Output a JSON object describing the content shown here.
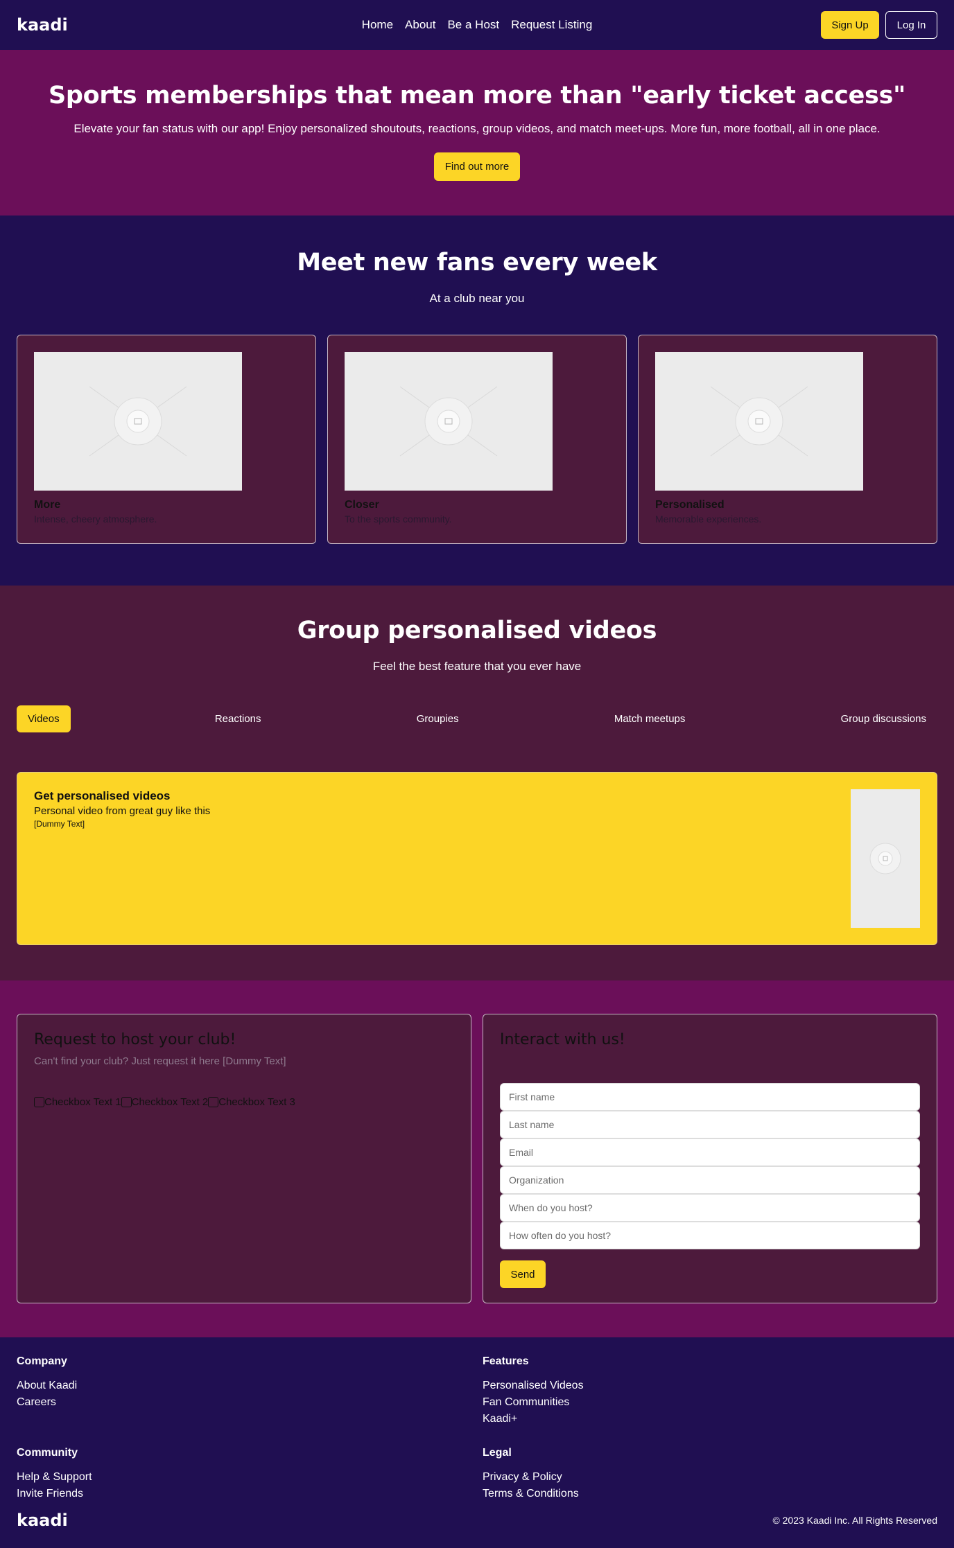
{
  "nav": {
    "logo": "kaadi",
    "links": [
      "Home",
      "About",
      "Be a Host",
      "Request Listing"
    ],
    "signup": "Sign Up",
    "login": "Log In"
  },
  "hero": {
    "title": "Sports memberships that mean more than \"early ticket access\"",
    "subtitle": "Elevate your fan status with our app! Enjoy personalized shoutouts, reactions, group videos, and match meet-ups. More fun, more football, all in one place.",
    "cta": "Find out more"
  },
  "meet": {
    "title": "Meet new fans every week",
    "subtitle": "At a club near you",
    "cards": [
      {
        "title": "More",
        "desc": "Intense, cheery atmosphere."
      },
      {
        "title": "Closer",
        "desc": "To the sports community."
      },
      {
        "title": "Personalised",
        "desc": "Memorable experiences."
      }
    ]
  },
  "group": {
    "title": "Group personalised videos",
    "subtitle": "Feel the best feature that you ever have",
    "tabs": [
      "Videos",
      "Reactions",
      "Groupies",
      "Match meetups",
      "Group discussions"
    ],
    "feature": {
      "title": "Get personalised videos",
      "desc": "Personal video from great guy like this",
      "dummy": "[Dummy Text]"
    }
  },
  "request": {
    "title": "Request to host your club!",
    "hint": "Can't find your club? Just request it here [Dummy Text]",
    "checkboxes": [
      "Checkbox Text 1",
      "Checkbox Text 2",
      "Checkbox Text 3"
    ]
  },
  "contact": {
    "title": "Interact with us!",
    "placeholders": [
      "First name",
      "Last name",
      "Email",
      "Organization",
      "When do you host?",
      "How often do you host?"
    ],
    "send": "Send"
  },
  "footer": {
    "columns": [
      {
        "heading": "Company",
        "links": [
          "About Kaadi",
          "Careers"
        ]
      },
      {
        "heading": "Features",
        "links": [
          "Personalised Videos",
          "Fan Communities",
          "Kaadi+"
        ]
      },
      {
        "heading": "Community",
        "links": [
          "Help & Support",
          "Invite Friends"
        ]
      },
      {
        "heading": "Legal",
        "links": [
          "Privacy & Policy",
          "Terms & Conditions"
        ]
      }
    ],
    "logo": "kaadi",
    "copyright": "© 2023 Kaadi Inc. All Rights Reserved"
  },
  "colors": {
    "navy": "#200f52",
    "magenta": "#6b0f59",
    "plum": "#4d1a3c",
    "accent_yellow": "#fcd526"
  },
  "icons": {
    "image_placeholder": "image-placeholder-icon"
  }
}
